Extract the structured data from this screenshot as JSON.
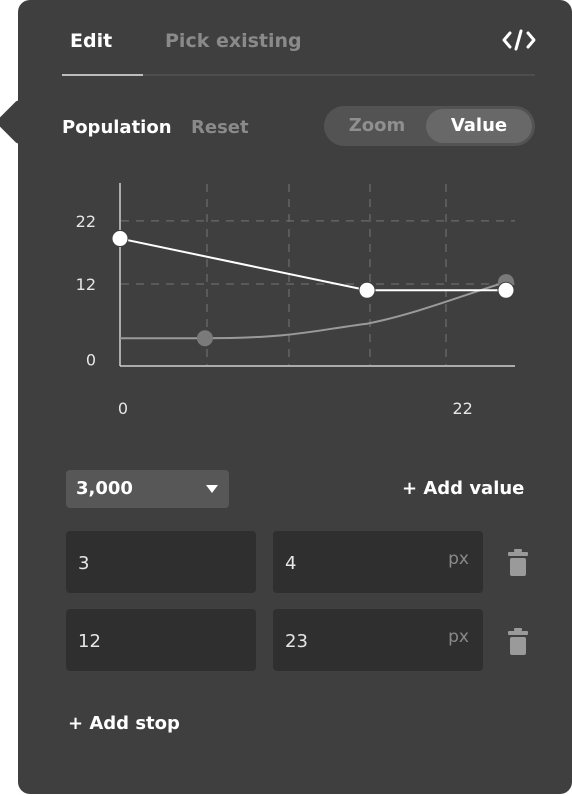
{
  "tabs": {
    "edit": "Edit",
    "pick_existing": "Pick existing"
  },
  "icons": {
    "code": "code-icon",
    "dropdown": "chevron-down-icon",
    "delete": "trash-icon"
  },
  "property": {
    "label": "Population",
    "reset": "Reset"
  },
  "mode_toggle": {
    "options": [
      "Zoom",
      "Value"
    ],
    "selected": "Value"
  },
  "chart_data": {
    "type": "line",
    "x_ticks": [
      "0",
      "22"
    ],
    "y_ticks": [
      "0",
      "12",
      "22"
    ],
    "xlim": [
      0,
      25
    ],
    "ylim": [
      -1,
      28
    ],
    "grid": "dashed",
    "series": [
      {
        "role": "stops",
        "points": [
          [
            0,
            19.2
          ],
          [
            16,
            11
          ],
          [
            25,
            11
          ]
        ]
      },
      {
        "role": "interpolated",
        "points": [
          [
            0,
            3.4
          ],
          [
            5.5,
            3.4
          ],
          [
            16,
            5.7
          ],
          [
            25,
            12.3
          ]
        ]
      }
    ]
  },
  "zoom_select": {
    "value": "3,000"
  },
  "add_value_label": "+ Add value",
  "stops": [
    {
      "input": "3",
      "output": "4",
      "unit": "px"
    },
    {
      "input": "12",
      "output": "23",
      "unit": "px"
    }
  ],
  "add_stop_label": "+ Add stop",
  "colors": {
    "panel": "#3f3f3f",
    "field": "#2f2f2f",
    "active_text": "#ffffff",
    "muted_text": "#8a8a8a"
  }
}
